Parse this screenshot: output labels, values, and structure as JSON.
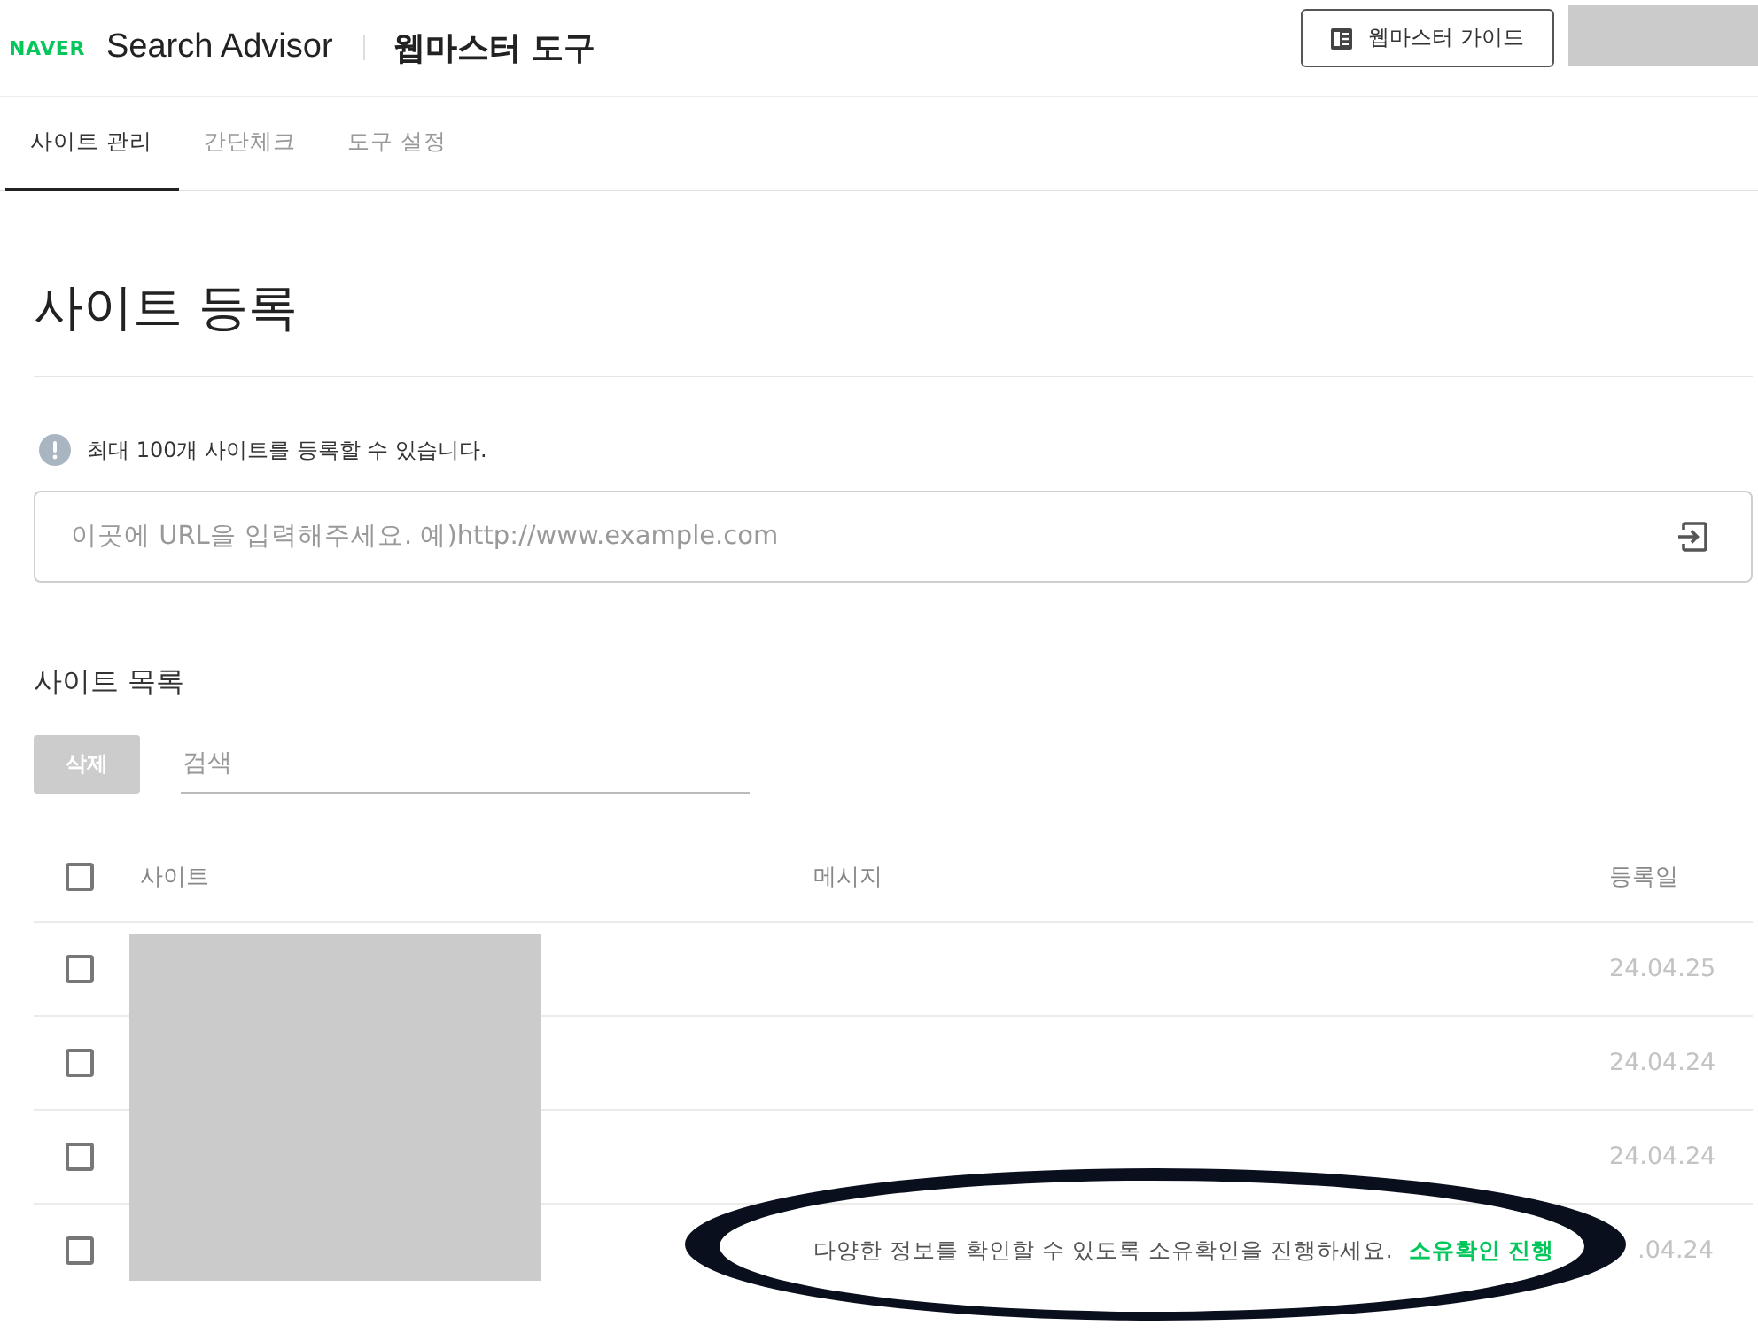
{
  "header": {
    "logo": "NAVER",
    "product": "Search Advisor",
    "section": "웹마스터 도구",
    "guide_button": "웹마스터 가이드",
    "account_redacted": true
  },
  "tabs": [
    {
      "label": "사이트 관리",
      "selected": true
    },
    {
      "label": "간단체크",
      "selected": false
    },
    {
      "label": "도구 설정",
      "selected": false
    }
  ],
  "page_title": "사이트 등록",
  "notice": "최대 100개 사이트를 등록할 수 있습니다.",
  "url_field": {
    "placeholder": "이곳에 URL을 입력해주세요. 예)http://www.example.com"
  },
  "site_list": {
    "title": "사이트 목록",
    "delete_button": {
      "label": "삭제",
      "disabled": true
    },
    "search": {
      "placeholder": "검색"
    },
    "table": {
      "columns": [
        "사이트",
        "메시지",
        "등록일"
      ],
      "all_checked": false,
      "sites_redacted": true,
      "rows": [
        {
          "checked": false,
          "date": "24.04.25"
        },
        {
          "checked": false,
          "date": "24.04.24"
        },
        {
          "checked": false,
          "date": "24.04.24"
        },
        {
          "checked": false,
          "message": "다양한 정보를 확인할 수 있도록 소유확인을 진행하세요.",
          "action": "소유확인 진행",
          "date": ".04.24"
        }
      ]
    }
  },
  "annotation": {
    "kind": "ellipse"
  }
}
